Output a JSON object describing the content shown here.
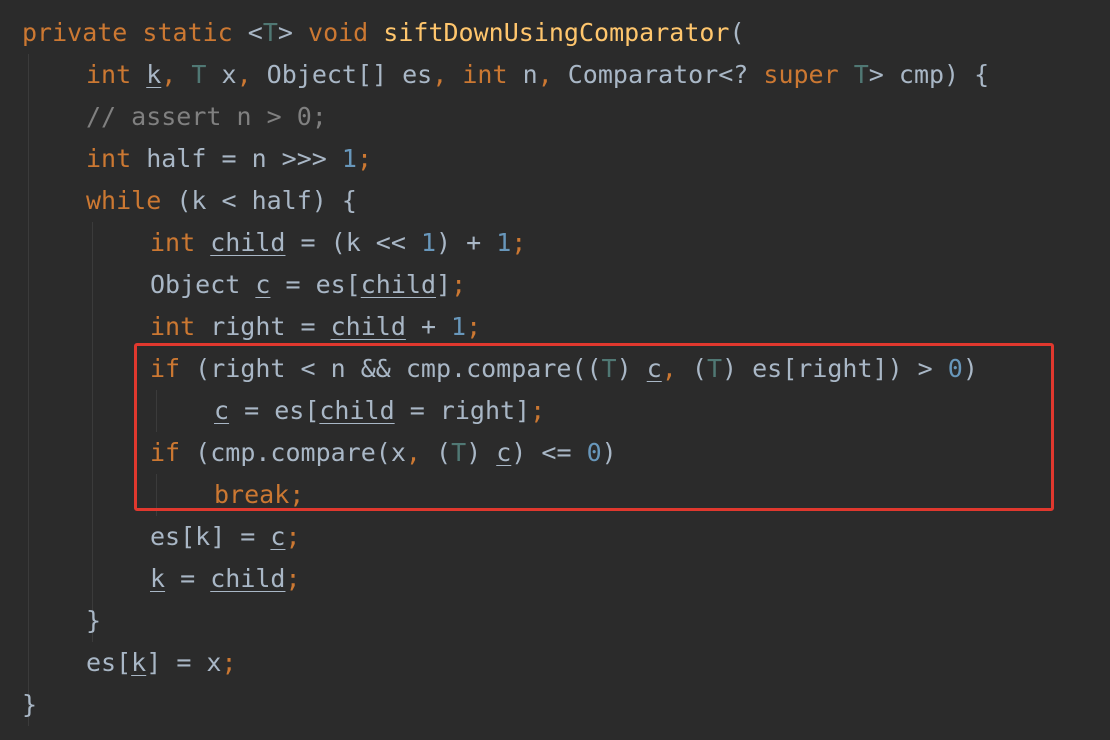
{
  "editor": {
    "highlight_color": "#e0382e",
    "colors": {
      "background": "#2b2b2b",
      "keyword": "#cc7832",
      "plain": "#a9b7c6",
      "number": "#6897bb",
      "comment": "#808080",
      "method": "#ffc66d",
      "typeparam": "#507874"
    },
    "lines": [
      {
        "indent": 0,
        "tokens": [
          {
            "t": "private",
            "k": "keyword"
          },
          {
            "t": " ",
            "k": "plain"
          },
          {
            "t": "static",
            "k": "keyword"
          },
          {
            "t": " <",
            "k": "plain"
          },
          {
            "t": "T",
            "k": "typeparam"
          },
          {
            "t": "> ",
            "k": "plain"
          },
          {
            "t": "void",
            "k": "keyword"
          },
          {
            "t": " ",
            "k": "plain"
          },
          {
            "t": "siftDownUsingComparator",
            "k": "method"
          },
          {
            "t": "(",
            "k": "plain"
          }
        ]
      },
      {
        "indent": 1,
        "tokens": [
          {
            "t": "int",
            "k": "keyword"
          },
          {
            "t": " ",
            "k": "plain"
          },
          {
            "t": "k",
            "k": "plain",
            "u": true
          },
          {
            "t": ", ",
            "k": "punct"
          },
          {
            "t": "T",
            "k": "typeparam"
          },
          {
            "t": " x",
            "k": "plain"
          },
          {
            "t": ", ",
            "k": "punct"
          },
          {
            "t": "Object[] es",
            "k": "plain"
          },
          {
            "t": ", ",
            "k": "punct"
          },
          {
            "t": "int",
            "k": "keyword"
          },
          {
            "t": " n",
            "k": "plain"
          },
          {
            "t": ", ",
            "k": "punct"
          },
          {
            "t": "Comparator<? ",
            "k": "plain"
          },
          {
            "t": "super",
            "k": "keyword"
          },
          {
            "t": " ",
            "k": "plain"
          },
          {
            "t": "T",
            "k": "typeparam"
          },
          {
            "t": "> cmp) {",
            "k": "plain"
          }
        ]
      },
      {
        "indent": 1,
        "tokens": [
          {
            "t": "// assert n > 0;",
            "k": "comment"
          }
        ]
      },
      {
        "indent": 1,
        "tokens": [
          {
            "t": "int",
            "k": "keyword"
          },
          {
            "t": " half = n >>> ",
            "k": "plain"
          },
          {
            "t": "1",
            "k": "number"
          },
          {
            "t": ";",
            "k": "punct"
          }
        ]
      },
      {
        "indent": 1,
        "tokens": [
          {
            "t": "while",
            "k": "keyword"
          },
          {
            "t": " (k < half) {",
            "k": "plain"
          }
        ]
      },
      {
        "indent": 2,
        "tokens": [
          {
            "t": "int",
            "k": "keyword"
          },
          {
            "t": " ",
            "k": "plain"
          },
          {
            "t": "child",
            "k": "plain",
            "u": true
          },
          {
            "t": " = (k << ",
            "k": "plain"
          },
          {
            "t": "1",
            "k": "number"
          },
          {
            "t": ") + ",
            "k": "plain"
          },
          {
            "t": "1",
            "k": "number"
          },
          {
            "t": ";",
            "k": "punct"
          }
        ]
      },
      {
        "indent": 2,
        "tokens": [
          {
            "t": "Object ",
            "k": "plain"
          },
          {
            "t": "c",
            "k": "plain",
            "u": true
          },
          {
            "t": " = es[",
            "k": "plain"
          },
          {
            "t": "child",
            "k": "plain",
            "u": true
          },
          {
            "t": "]",
            "k": "plain"
          },
          {
            "t": ";",
            "k": "punct"
          }
        ]
      },
      {
        "indent": 2,
        "tokens": [
          {
            "t": "int",
            "k": "keyword"
          },
          {
            "t": " right = ",
            "k": "plain"
          },
          {
            "t": "child",
            "k": "plain",
            "u": true
          },
          {
            "t": " + ",
            "k": "plain"
          },
          {
            "t": "1",
            "k": "number"
          },
          {
            "t": ";",
            "k": "punct"
          }
        ]
      },
      {
        "indent": 2,
        "tokens": [
          {
            "t": "if",
            "k": "keyword"
          },
          {
            "t": " (right < n && cmp.compare((",
            "k": "plain"
          },
          {
            "t": "T",
            "k": "typeparam"
          },
          {
            "t": ") ",
            "k": "plain"
          },
          {
            "t": "c",
            "k": "plain",
            "u": true
          },
          {
            "t": ", ",
            "k": "punct"
          },
          {
            "t": "(",
            "k": "plain"
          },
          {
            "t": "T",
            "k": "typeparam"
          },
          {
            "t": ") es[right]) > ",
            "k": "plain"
          },
          {
            "t": "0",
            "k": "number"
          },
          {
            "t": ")",
            "k": "plain"
          }
        ]
      },
      {
        "indent": 3,
        "tokens": [
          {
            "t": "c",
            "k": "plain",
            "u": true
          },
          {
            "t": " = es[",
            "k": "plain"
          },
          {
            "t": "child",
            "k": "plain",
            "u": true
          },
          {
            "t": " = right]",
            "k": "plain"
          },
          {
            "t": ";",
            "k": "punct"
          }
        ]
      },
      {
        "indent": 2,
        "tokens": [
          {
            "t": "if",
            "k": "keyword"
          },
          {
            "t": " (cmp.compare(x",
            "k": "plain"
          },
          {
            "t": ", ",
            "k": "punct"
          },
          {
            "t": "(",
            "k": "plain"
          },
          {
            "t": "T",
            "k": "typeparam"
          },
          {
            "t": ") ",
            "k": "plain"
          },
          {
            "t": "c",
            "k": "plain",
            "u": true
          },
          {
            "t": ") <= ",
            "k": "plain"
          },
          {
            "t": "0",
            "k": "number"
          },
          {
            "t": ")",
            "k": "plain"
          }
        ]
      },
      {
        "indent": 3,
        "tokens": [
          {
            "t": "break",
            "k": "keyword"
          },
          {
            "t": ";",
            "k": "punct"
          }
        ]
      },
      {
        "indent": 2,
        "tokens": [
          {
            "t": "es[k] = ",
            "k": "plain"
          },
          {
            "t": "c",
            "k": "plain",
            "u": true
          },
          {
            "t": ";",
            "k": "punct"
          }
        ]
      },
      {
        "indent": 2,
        "tokens": [
          {
            "t": "k",
            "k": "plain",
            "u": true
          },
          {
            "t": " = ",
            "k": "plain"
          },
          {
            "t": "child",
            "k": "plain",
            "u": true
          },
          {
            "t": ";",
            "k": "punct"
          }
        ]
      },
      {
        "indent": 1,
        "tokens": [
          {
            "t": "}",
            "k": "plain"
          }
        ]
      },
      {
        "indent": 1,
        "tokens": [
          {
            "t": "es[",
            "k": "plain"
          },
          {
            "t": "k",
            "k": "plain",
            "u": true
          },
          {
            "t": "] = x",
            "k": "plain"
          },
          {
            "t": ";",
            "k": "punct"
          }
        ]
      },
      {
        "indent": 0,
        "tokens": [
          {
            "t": "}",
            "k": "plain"
          }
        ]
      }
    ]
  }
}
